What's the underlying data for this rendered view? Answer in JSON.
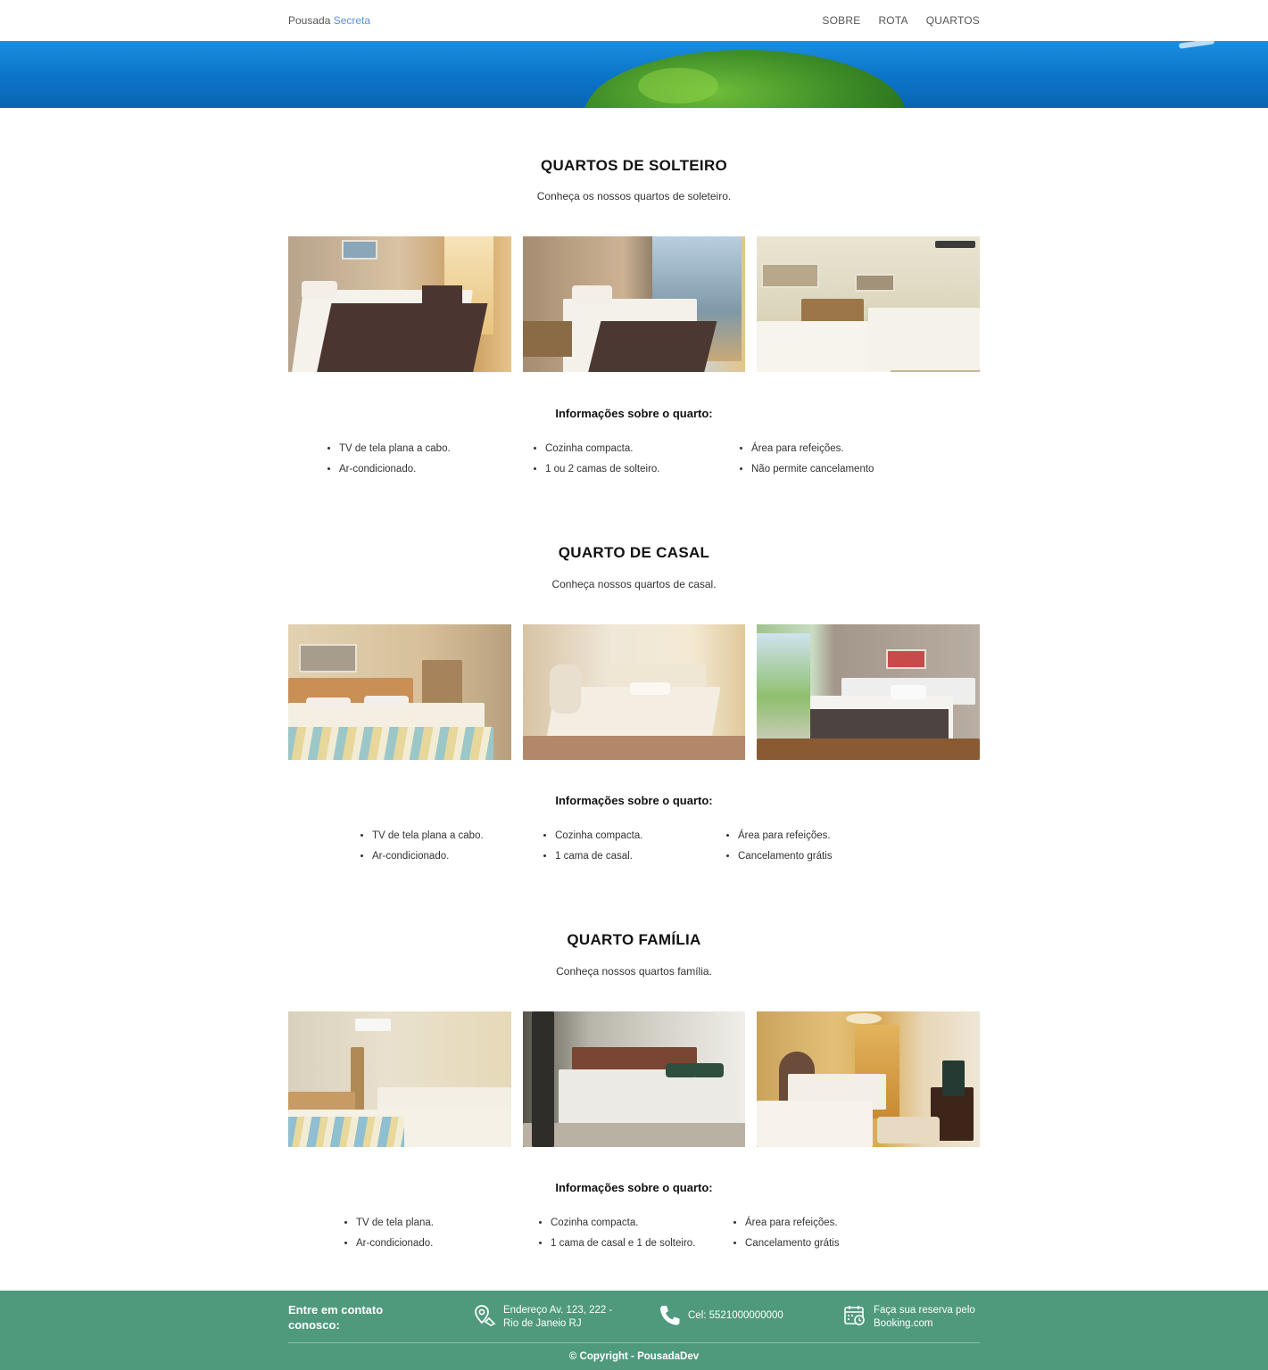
{
  "nav": {
    "brand_main": "Pousada",
    "brand_accent": "Secreta",
    "links": [
      "SOBRE",
      "ROTA",
      "QUARTOS"
    ]
  },
  "sections": [
    {
      "title": "QUARTOS DE SOLTEIRO",
      "subtitle": "Conheça os nossos quartos de soleteiro.",
      "info_title": "Informações sobre o quarto:",
      "col1": [
        "TV de tela plana a cabo.",
        "Ar-condicionado."
      ],
      "col2": [
        "Cozinha compacta.",
        "1 ou 2 camas de solteiro."
      ],
      "col3": [
        "Área para refeições.",
        "Não permite cancelamento"
      ]
    },
    {
      "title": "QUARTO DE CASAL",
      "subtitle": "Conheça nossos quartos de casal.",
      "info_title": "Informações sobre o quarto:",
      "col1": [
        "TV de tela plana a cabo.",
        "Ar-condicionado."
      ],
      "col2": [
        "Cozinha compacta.",
        "1 cama de casal."
      ],
      "col3": [
        "Área para refeições.",
        "Cancelamento grátis"
      ]
    },
    {
      "title": "QUARTO FAMÍLIA",
      "subtitle": "Conheça nossos quartos família.",
      "info_title": "Informações sobre o quarto:",
      "col1": [
        "TV de tela plana.",
        "Ar-condicionado."
      ],
      "col2": [
        "Cozinha compacta.",
        "1 cama de casal e 1 de solteiro."
      ],
      "col3": [
        "Área para refeições.",
        "Cancelamento grátis"
      ]
    }
  ],
  "footer": {
    "contact_title": "Entre em contato conosco:",
    "address_line1": "Endereço Av. 123, 222 -",
    "address_line2": "Rio de Janeio RJ",
    "phone": "Cel: 5521000000000",
    "booking_line1": "Faça sua reserva pelo",
    "booking_line2": "Booking.com",
    "copyright": "© Copyright - PousadaDev"
  },
  "colors": {
    "footer_bg": "#4f9a7c",
    "brand_accent": "#5b8fd6"
  },
  "icons": [
    "location-pin-icon",
    "phone-icon",
    "calendar-icon"
  ]
}
